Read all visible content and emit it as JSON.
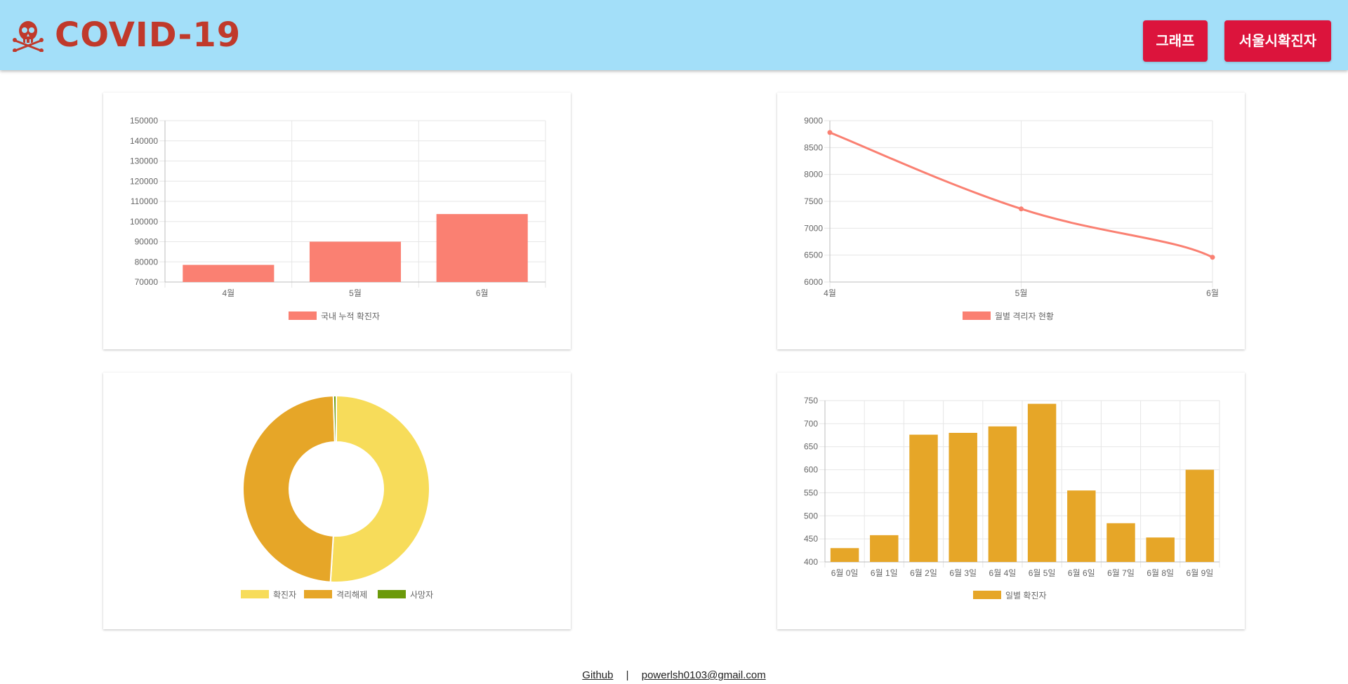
{
  "header": {
    "title": "COVID-19",
    "buttons": [
      "그래프",
      "서울시확진자"
    ]
  },
  "colors": {
    "header_bg": "#a3dff9",
    "brand": "#c0392b",
    "button": "#dc143c",
    "salmon": "#fa8072",
    "gold": "#e6a628",
    "yellow": "#f7dc5a",
    "green": "#6b9a0a"
  },
  "chart_data": [
    {
      "type": "bar",
      "categories": [
        "4월",
        "5월",
        "6월"
      ],
      "series": [
        {
          "name": "국내 누적 확진자",
          "values": [
            78500,
            90000,
            103700
          ]
        }
      ],
      "ylim": [
        70000,
        150000
      ],
      "yticks": [
        70000,
        80000,
        90000,
        100000,
        110000,
        120000,
        130000,
        140000,
        150000
      ],
      "grid": true,
      "legend": "bottom"
    },
    {
      "type": "line",
      "categories": [
        "4월",
        "5월",
        "6월"
      ],
      "series": [
        {
          "name": "월별 격리자 현황",
          "values": [
            8780,
            7360,
            6460
          ]
        }
      ],
      "ylim": [
        6000,
        9000
      ],
      "yticks": [
        6000,
        6500,
        7000,
        7500,
        8000,
        8500,
        9000
      ],
      "grid": true,
      "legend": "bottom"
    },
    {
      "type": "pie",
      "labels": [
        "확진자",
        "격리해제",
        "사망자"
      ],
      "values": [
        51,
        48.5,
        0.5
      ],
      "legend": "bottom"
    },
    {
      "type": "bar",
      "categories": [
        "6월 0일",
        "6월 1일",
        "6월 2일",
        "6월 3일",
        "6월 4일",
        "6월 5일",
        "6월 6일",
        "6월 7일",
        "6월 8일",
        "6월 9일"
      ],
      "series": [
        {
          "name": "일별 확진자",
          "values": [
            430,
            458,
            676,
            680,
            694,
            743,
            555,
            484,
            453,
            600
          ]
        }
      ],
      "ylim": [
        400,
        750
      ],
      "yticks": [
        400,
        450,
        500,
        550,
        600,
        650,
        700,
        750
      ],
      "grid": true,
      "legend": "bottom"
    }
  ],
  "footer": {
    "github": "Github",
    "separator": "|",
    "email": "powerlsh0103@gmail.com"
  }
}
